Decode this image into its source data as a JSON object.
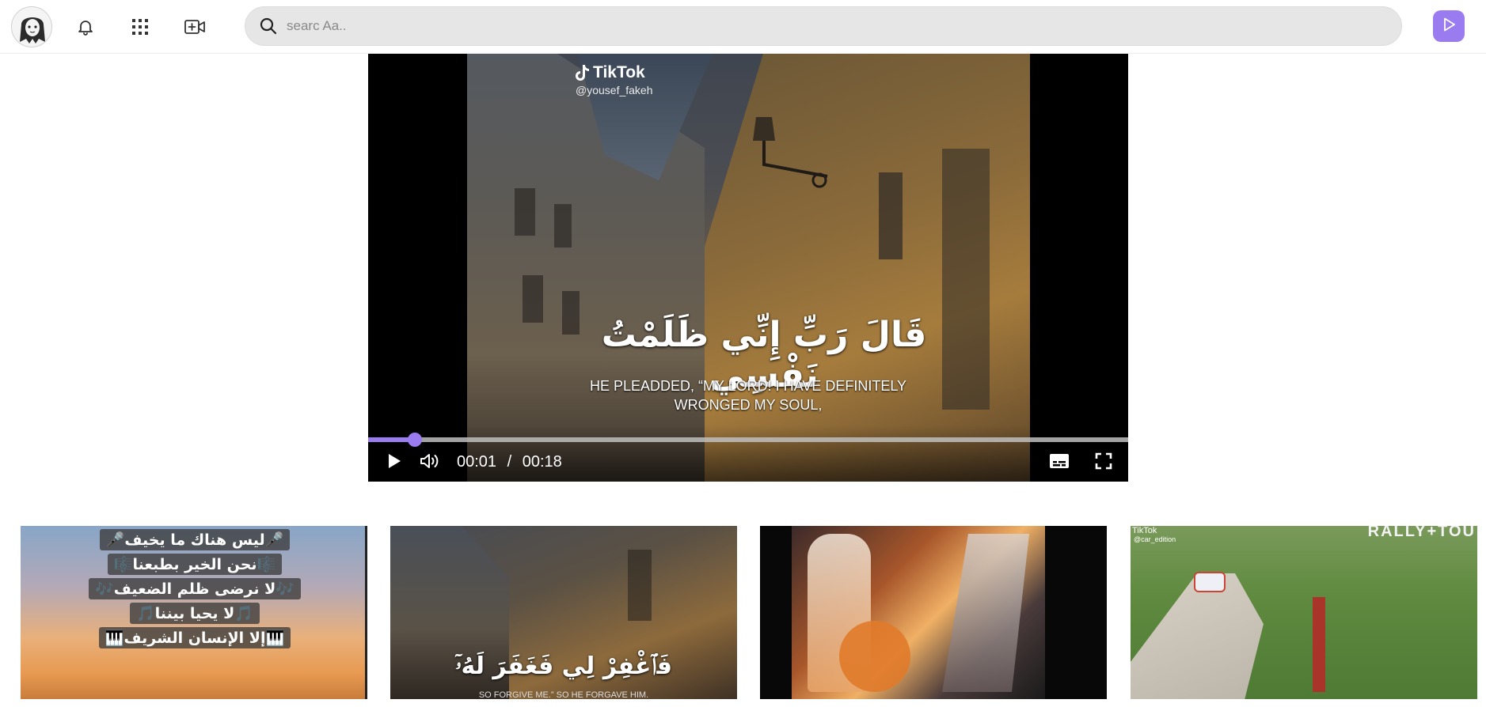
{
  "topbar": {
    "search": {
      "placeholder": "searc Aa.."
    },
    "icons": [
      "profile-avatar",
      "bell-icon",
      "apps-grid-icon",
      "video-add-icon",
      "search-icon",
      "play-icon"
    ]
  },
  "player": {
    "overlay_brand": "TikTok",
    "overlay_handle": "@yousef_fakeh",
    "caption_arabic": "قَالَ رَبِّ إِنِّي ظَلَمْتُ نَفْسِي",
    "caption_english_line1": "HE PLEADDED, “MY LORD! I HAVE DEFINITELY",
    "caption_english_line2": "WRONGED MY SOUL,",
    "current_time": "00:01",
    "separator": "/",
    "duration": "00:18",
    "progress": 0.061,
    "accent": "#9a7bf0"
  },
  "thumbnails": [
    {
      "lines": [
        "🎤ليس هناك ما يخيف🎤",
        "🎼نحن الخير بطبعنا🎼",
        "🎶لا نرضى ظلم الضعيف🎶",
        "🎵لا يحيا بيننا🎵",
        "🎹إلا الإنسان الشريف🎹"
      ]
    },
    {
      "caption": "فَٱغْفِرْ لِي فَغَفَرَ لَهُۥٓ",
      "subcaption": "SO FORGIVE ME.” SO HE FORGAVE HIM."
    },
    {},
    {
      "brand": "TikTok",
      "handle": "@car_edition",
      "title": "RALLY+TOU"
    }
  ]
}
